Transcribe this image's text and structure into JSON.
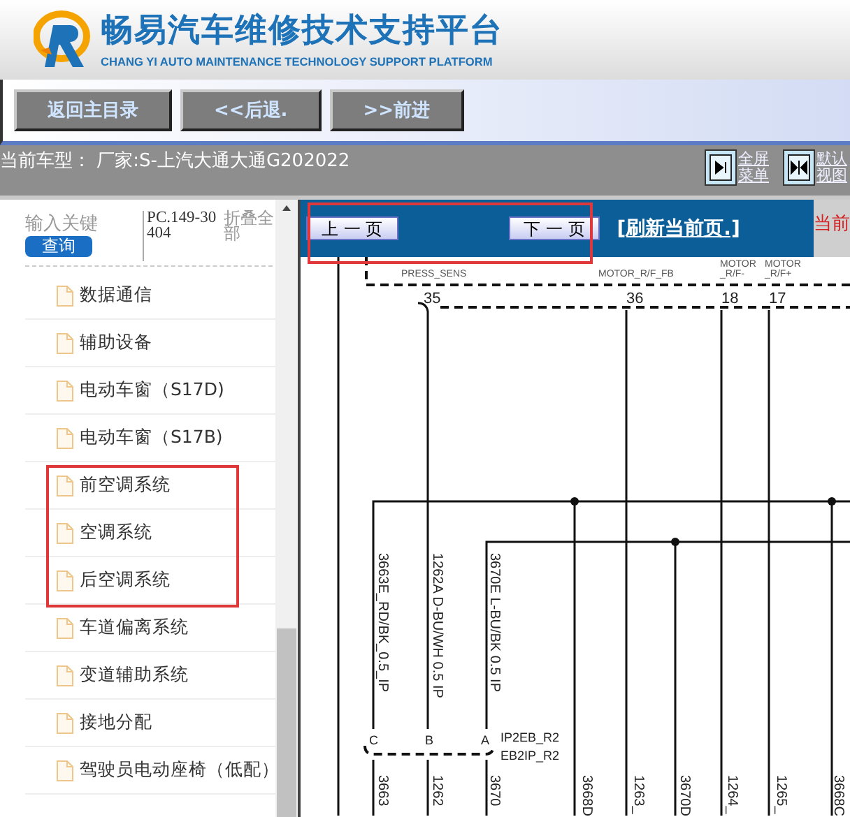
{
  "header": {
    "title": "畅易汽车维修技术支持平台",
    "subtitle": "CHANG YI AUTO MAINTENANCE TECHNOLOGY SUPPORT PLATFORM"
  },
  "nav_buttons": [
    "返回主目录",
    "<<后退.",
    ">>前进"
  ],
  "vehicle_bar": {
    "label": "当前车型： 厂家:S-上汽大通大通G202022",
    "actions": [
      {
        "kind": "fullscreen",
        "label": "全屏菜单"
      },
      {
        "kind": "default",
        "label": "默认视图"
      }
    ]
  },
  "sidebar": {
    "search": {
      "placeholder": "输入关键",
      "button": "查询"
    },
    "code": "PC.149-30404",
    "collapse": "折叠全部",
    "items": [
      {
        "label": "数据通信",
        "annotated": false
      },
      {
        "label": "辅助设备",
        "annotated": false
      },
      {
        "label": "电动车窗（S17D)",
        "annotated": false
      },
      {
        "label": "电动车窗（S17B)",
        "annotated": false
      },
      {
        "label": "前空调系统",
        "annotated": true
      },
      {
        "label": "空调系统",
        "annotated": true
      },
      {
        "label": "后空调系统",
        "annotated": true
      },
      {
        "label": "车道偏离系统",
        "annotated": false
      },
      {
        "label": "变道辅助系统",
        "annotated": false
      },
      {
        "label": "接地分配",
        "annotated": false
      },
      {
        "label": "驾驶员电动座椅（低配）",
        "annotated": false
      }
    ]
  },
  "pager": {
    "prev": "上 一 页",
    "next": "下 一 页",
    "refresh": "[刷新当前页.]",
    "annotated": true,
    "current": "当前"
  },
  "diagram": {
    "top_labels": [
      {
        "lines": [
          "PRESS_SENS"
        ]
      },
      {
        "lines": [
          "MOTOR_R/F_FB"
        ]
      },
      {
        "lines": [
          "MOTOR",
          "_R/F-"
        ]
      },
      {
        "lines": [
          "MOTOR",
          "_R/F+"
        ]
      }
    ],
    "pins": [
      "35",
      "36",
      "18",
      "17"
    ],
    "wire_labels": [
      "3663E_RD/BK_0.5_IP",
      "1262A D-BU/WH 0.5 IP",
      "3670E L-BU/BK 0.5 IP"
    ],
    "connector_pins": [
      "C",
      "B",
      "A"
    ],
    "connector_names": [
      "IP2EB_R2",
      "EB2IP_R2"
    ],
    "bottom_labels": [
      "3663",
      "1262",
      "3670",
      "3668D",
      "1263_",
      "3670D",
      "1264_",
      "1265_",
      "3668C"
    ]
  }
}
